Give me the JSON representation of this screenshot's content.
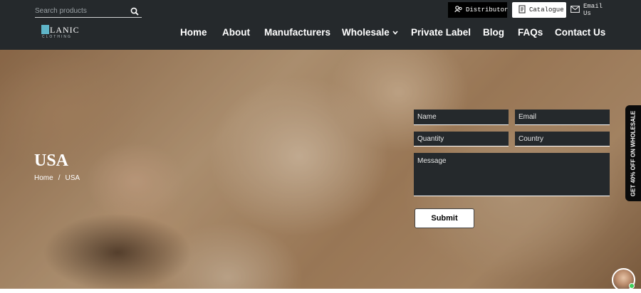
{
  "header": {
    "search": {
      "placeholder": "Search products",
      "icon": "search-icon"
    },
    "logo": {
      "name": "LANIC",
      "mark": "A",
      "sub": "CLOTHING"
    },
    "top_buttons": {
      "distributor": {
        "label": "Distributor",
        "icon": "distributor-icon"
      },
      "catalogue": {
        "label": "Catalogue",
        "icon": "catalogue-icon"
      },
      "email": {
        "label": "Email Us",
        "icon": "mail-icon"
      }
    },
    "nav": [
      {
        "label": "Home"
      },
      {
        "label": "About"
      },
      {
        "label": "Manufacturers"
      },
      {
        "label": "Wholesale",
        "has_dropdown": true
      },
      {
        "label": "Private Label"
      },
      {
        "label": "Blog"
      },
      {
        "label": "FAQs"
      },
      {
        "label": "Contact Us"
      }
    ]
  },
  "hero": {
    "title": "USA",
    "breadcrumb": {
      "home": "Home",
      "separator": "/",
      "current": "USA"
    }
  },
  "form": {
    "name_placeholder": "Name",
    "email_placeholder": "Email",
    "quantity_placeholder": "Quantity",
    "country_placeholder": "Country",
    "message_placeholder": "Message",
    "submit_label": "Submit"
  },
  "side_tab": {
    "label": "GET 40% OFF ON WHOLESALE"
  },
  "colors": {
    "header_bg": "#25292c",
    "field_bg": "#25292c",
    "logo_accent": "#5fb5c8",
    "online_dot": "#3ecf5a"
  }
}
